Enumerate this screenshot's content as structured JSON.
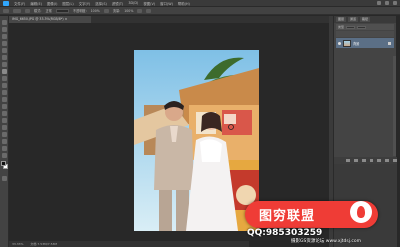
{
  "app": {
    "menu": [
      "文件(F)",
      "编辑(E)",
      "图像(I)",
      "图层(L)",
      "文字(Y)",
      "选择(S)",
      "滤镜(T)",
      "3D(D)",
      "视图(V)",
      "窗口(W)",
      "帮助(H)"
    ]
  },
  "options_bar": {
    "labels": [
      "模式:",
      "正常",
      "不透明度:",
      "100%",
      "流量:",
      "100%"
    ]
  },
  "document": {
    "tab_title": "IMG_6650.JPG @ 33.3%(RGB/8*) ×"
  },
  "status_bar": {
    "zoom": "33.33%",
    "doc_info": "文档:7.53M/7.53M"
  },
  "panels": {
    "tabs": [
      "图层",
      "通道",
      "路径"
    ],
    "kind_label": "类型",
    "layer_name": "背景"
  },
  "watermark": {
    "title": "图穷联盟",
    "qq": "QQ:985303259",
    "site": "摄影GS资源论坛 www.xjtdsj.com"
  },
  "colors": {
    "accent_red": "#ef3c36",
    "ui_bg": "#282828",
    "panel_bg": "#444444",
    "ps_blue": "#31a8ff"
  },
  "icons": [
    "photoshop-logo-icon",
    "eye-icon",
    "lock-icon",
    "brush-icon",
    "move-icon",
    "marquee-icon",
    "lasso-icon",
    "crop-icon",
    "eyedropper-icon",
    "eraser-icon",
    "text-icon",
    "hand-icon",
    "zoom-icon",
    "flame-logo-icon"
  ]
}
